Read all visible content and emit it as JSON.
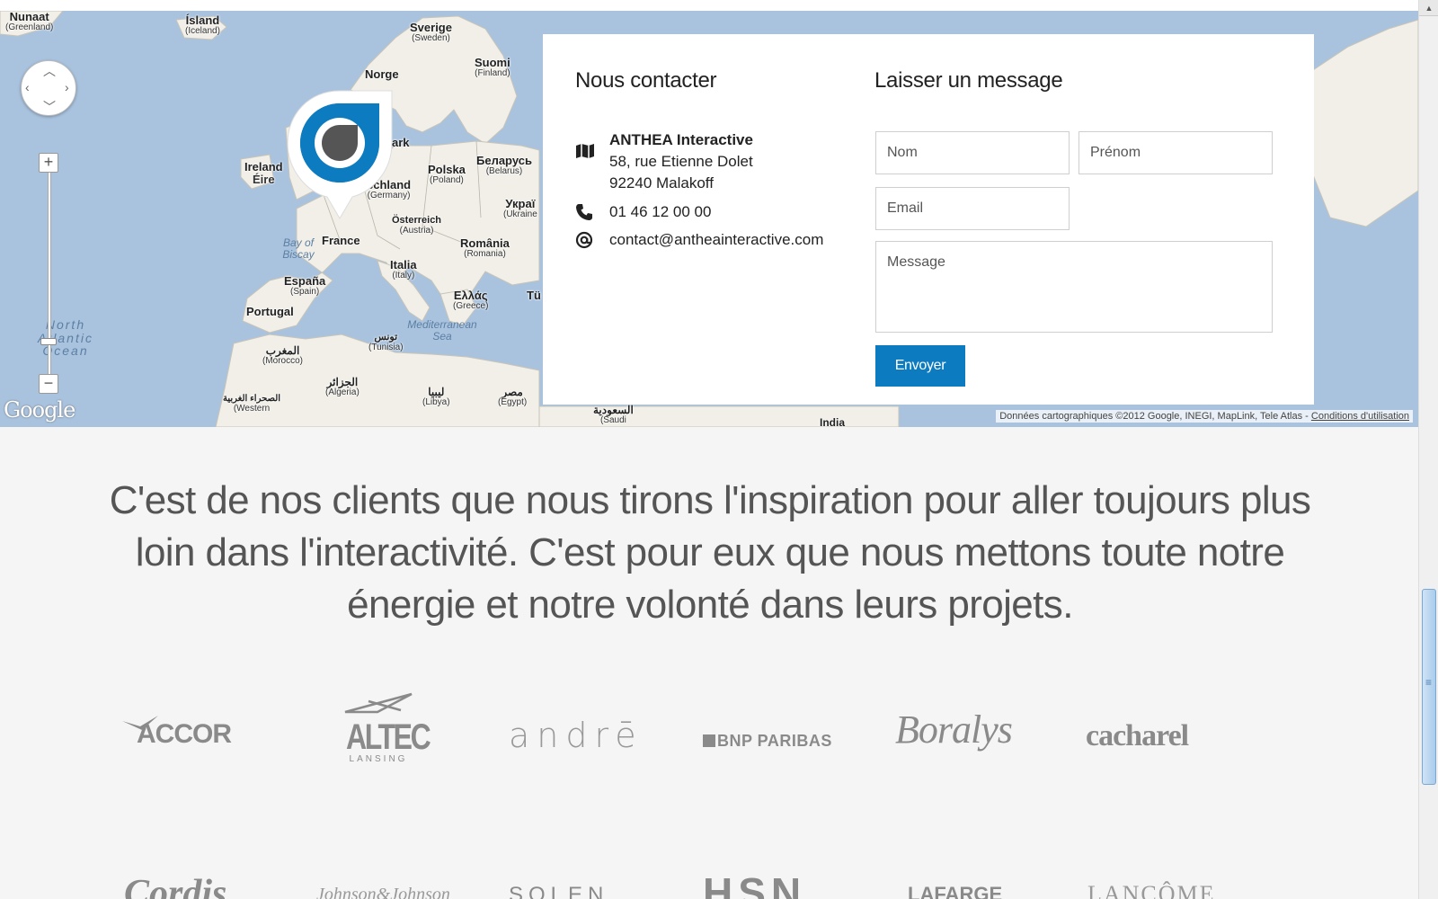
{
  "map": {
    "labels": {
      "nunaat": {
        "name": "Nunaat",
        "sub": "(Greenland)"
      },
      "island": {
        "name": "Ísland",
        "sub": "(Iceland)"
      },
      "sverige": {
        "name": "Sverige",
        "sub": "(Sweden)"
      },
      "suomi": {
        "name": "Suomi",
        "sub": "(Finland)"
      },
      "norge": {
        "name": "Norge",
        "sub": ""
      },
      "ireland": {
        "name": "Ireland",
        "sub": "Éire"
      },
      "polska": {
        "name": "Polska",
        "sub": "(Poland)"
      },
      "belarus": {
        "name": "Беларусь",
        "sub": "(Belarus)"
      },
      "deutschland": {
        "name": "schland",
        "sub": "(Germany)"
      },
      "ukraine": {
        "name": "Украї",
        "sub": "(Ukraine"
      },
      "osterreich": {
        "name": "Österreich",
        "sub": "(Austria)"
      },
      "france": {
        "name": "France",
        "sub": ""
      },
      "romania": {
        "name": "România",
        "sub": "(Romania)"
      },
      "espana": {
        "name": "España",
        "sub": "(Spain)"
      },
      "italia": {
        "name": "Italia",
        "sub": "(Italy)"
      },
      "portugal": {
        "name": "Portugal",
        "sub": ""
      },
      "ellas": {
        "name": "Ελλάς",
        "sub": "(Greece)"
      },
      "morocco": {
        "name": "المغرب",
        "sub": "(Morocco)"
      },
      "tunisia": {
        "name": "تونس",
        "sub": "(Tunisia)"
      },
      "algeria": {
        "name": "الجزائر",
        "sub": "(Algeria)"
      },
      "libya": {
        "name": "ليبيا",
        "sub": "(Libya)"
      },
      "egypt": {
        "name": "مصر",
        "sub": "(Egypt)"
      },
      "saudi": {
        "name": "السعودية",
        "sub": "(Saudi"
      },
      "western_sahara": {
        "name": "الصحراء الغربية",
        "sub": "(Western"
      },
      "india": {
        "name": "India",
        "sub": ""
      },
      "tu": {
        "name": "Tü",
        "sub": ""
      },
      "ark": {
        "name": "ark",
        "sub": ""
      },
      "bay_of_biscay": "Bay of Biscay",
      "north_atlantic": "North Atlantic Ocean",
      "mediterranean": "Mediterranean Sea"
    },
    "google_logo": "Google",
    "attribution": "Données cartographiques ©2012 Google, INEGI, MapLink, Tele Atlas - ",
    "terms_link": "Conditions d'utilisation",
    "zoom_in": "+",
    "zoom_out": "−"
  },
  "contact": {
    "title": "Nous contacter",
    "company": "ANTHEA Interactive",
    "address_line1": "58, rue Etienne Dolet",
    "address_line2": "92240 Malakoff",
    "phone": "01 46 12 00 00",
    "email": "contact@antheainteractive.com"
  },
  "form": {
    "title": "Laisser un message",
    "nom_placeholder": "Nom",
    "prenom_placeholder": "Prénom",
    "email_placeholder": "Email",
    "message_placeholder": "Message",
    "submit_label": "Envoyer"
  },
  "tagline": "C'est de nos clients que nous tirons l'inspiration pour aller toujours plus loin dans l'interactivité. C'est pour eux que nous mettons toute notre énergie et notre volonté dans leurs projets.",
  "clients": {
    "accor": "ACCOR",
    "altec": "ALTEC",
    "altec_sub": "LANSING",
    "andre": "andrē",
    "bnp": "BNP PARIBAS",
    "boralys": "Boralys",
    "cacharel": "cacharel",
    "cordis": "Cordis",
    "johnson": "Johnson&Johnson",
    "solen": "SOLEN",
    "hsn": "HSN",
    "lafarge": "LAFARGE",
    "lancome": "LANCÔME"
  },
  "colors": {
    "accent": "#0d7bbf",
    "map_water": "#a9c3df",
    "map_land": "#f1efe8"
  }
}
